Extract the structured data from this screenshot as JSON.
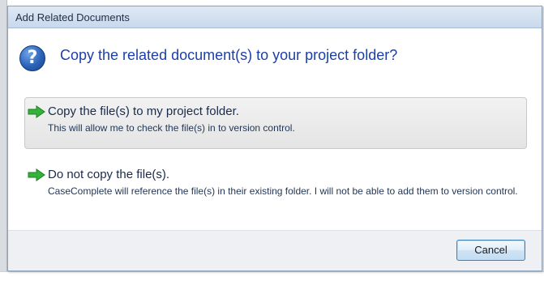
{
  "dialog": {
    "title": "Add Related Documents",
    "header": "Copy the related document(s) to your project folder?"
  },
  "icons": {
    "question": "question-icon",
    "question_glyph": "?",
    "arrow": "green-arrow-icon"
  },
  "options": [
    {
      "title": "Copy the file(s) to my project folder.",
      "description": "This will allow me to check the file(s) in to version control."
    },
    {
      "title": "Do not copy the file(s).",
      "description": "CaseComplete will reference the file(s) in their existing folder. I will not be able to add them to version control."
    }
  ],
  "footer": {
    "cancel_label": "Cancel"
  },
  "colors": {
    "header_text": "#1c3fa8",
    "arrow_green": "#33b33a",
    "button_border": "#3c7fb1"
  }
}
